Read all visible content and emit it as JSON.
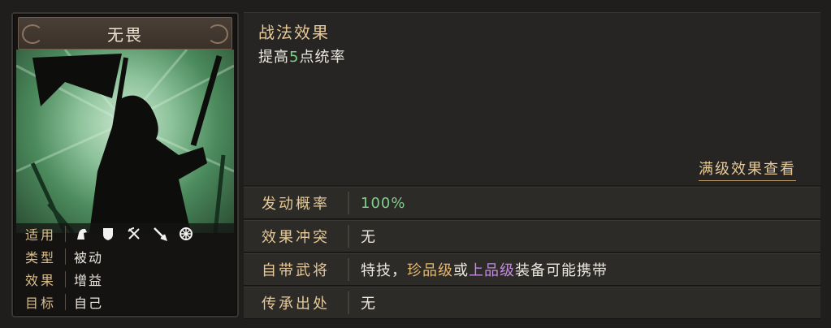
{
  "card": {
    "title": "无畏",
    "info": [
      {
        "label": "适用",
        "icons": [
          "cavalry-icon",
          "shield-icon",
          "crossbow-icon",
          "spear-icon",
          "siege-wheel-icon"
        ]
      },
      {
        "label": "类型",
        "value": "被动"
      },
      {
        "label": "效果",
        "value": "增益"
      },
      {
        "label": "目标",
        "value": "自己"
      }
    ]
  },
  "effect": {
    "heading": "战法效果",
    "desc_prefix": "提高",
    "desc_number": "5",
    "desc_suffix": "点统率",
    "view_max_label": "满级效果查看"
  },
  "attributes": [
    {
      "label": "发动概率",
      "value": "100%"
    },
    {
      "label": "效果冲突",
      "value": "无"
    },
    {
      "label": "自带武将",
      "value_parts": [
        "特技，",
        "珍品级",
        "或",
        "上品级",
        "装备可能携带"
      ]
    },
    {
      "label": "传承出处",
      "value": "无"
    }
  ],
  "colors": {
    "accent_gold": "#e5c998",
    "value_green": "#7fd08a",
    "rare_gold": "#e3b76d",
    "epic_purple": "#c48be0"
  }
}
